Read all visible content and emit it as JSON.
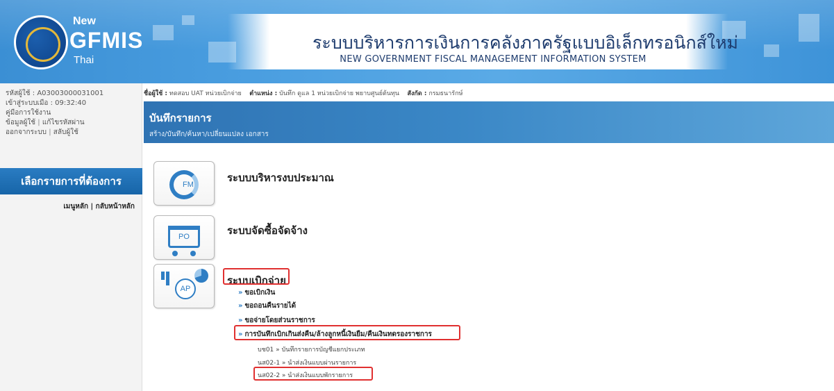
{
  "header": {
    "logo": {
      "new": "New",
      "gfmis": "GFMIS",
      "thai": "Thai"
    },
    "title_th": "ระบบบริหารการเงินการคลังภาครัฐแบบอิเล็กทรอนิกส์ใหม่",
    "title_en": "NEW GOVERNMENT FISCAL MANAGEMENT INFORMATION SYSTEM"
  },
  "sidebar": {
    "user_code": "รหัสผู้ใช้ : A03003000031001",
    "login_time": "เข้าสู่ระบบเมื่อ : 09:32:40",
    "manual": "คู่มือการใช้งาน",
    "user_info": "ข้อมูลผู้ใช้",
    "change_password": "แก้ไขรหัสผ่าน",
    "logout": "ออกจากระบบ",
    "switch_user": "สลับผู้ใช้",
    "menu_header": "เลือกรายการที่ต้องการ",
    "main_menu": "เมนูหลัก",
    "home": "กลับหน้าหลัก"
  },
  "user_line": {
    "name_label": "ชื่อผู้ใช้ :",
    "name_value": "ทดสอบ UAT หน่วยเบิกจ่าย",
    "position_label": "ตำแหน่ง :",
    "position_value": "บันทึก ดูแล 1 หน่วยเบิกจ่าย พยาบศูนย์ต้นทุน",
    "org_label": "สังกัด :",
    "org_value": "กรมธนารักษ์"
  },
  "page": {
    "title": "บันทึกรายการ",
    "subtitle": "สร้าง/บันทึก/ค้นหา/เปลี่ยนแปลง เอกสาร"
  },
  "systems": {
    "fm": {
      "icon_label": "FM",
      "title": "ระบบบริหารงบประมาณ"
    },
    "po": {
      "icon_label": "PO",
      "title": "ระบบจัดซื้อจัดจ้าง"
    },
    "ap": {
      "icon_label": "AP",
      "title": "ระบบเบิกจ่าย",
      "links": [
        "ขอเบิกเงิน",
        "ขอถอนคืนรายได้",
        "ขอจ่ายโดยส่วนราชการ",
        "การบันทึกเบิกเกินส่งคืน/ล้างลูกหนี้เงินยืม/คืนเงินทดรองราชการ"
      ],
      "sub_links": [
        "บช01 » บันทึกรายการบัญชีแยกประเภท",
        "นส02-1 » นำส่งเงินแบบผ่านรายการ",
        "นส02-2 » นำส่งเงินแบบพักรายการ"
      ]
    }
  },
  "colors": {
    "accent": "#2f7ec4",
    "highlight": "#e03030"
  }
}
